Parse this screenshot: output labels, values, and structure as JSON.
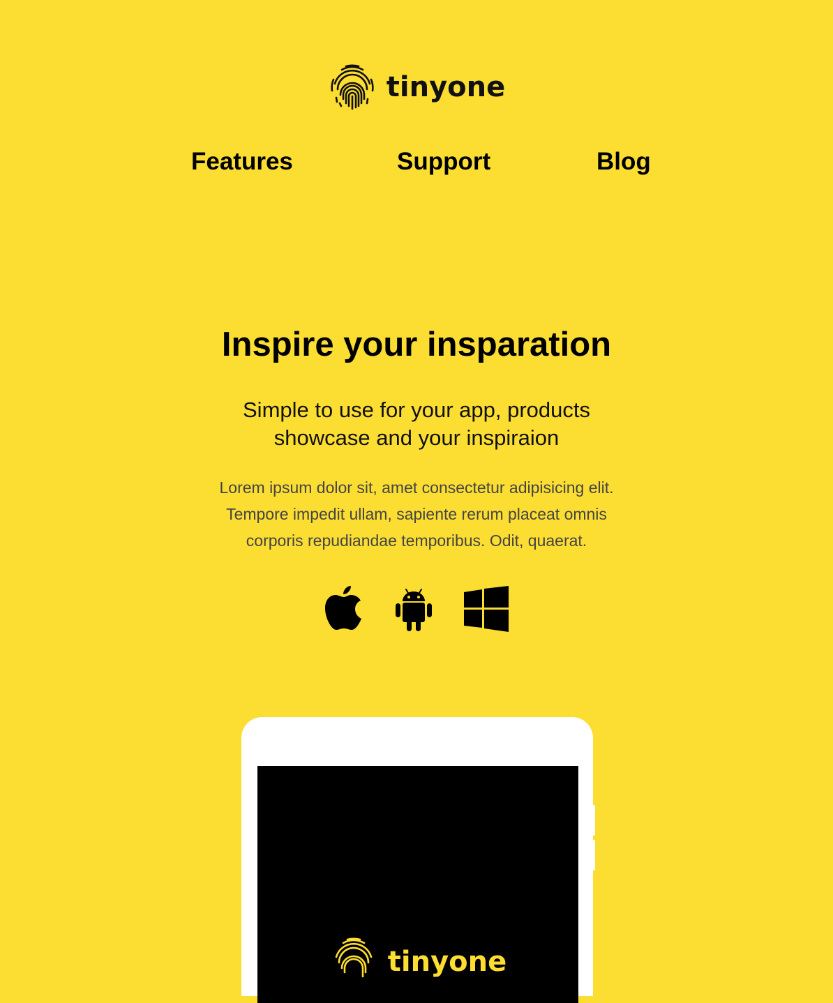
{
  "brand": {
    "name": "tinyone",
    "logo_icon": "fingerprint-icon"
  },
  "nav": {
    "items": [
      {
        "label": "Features"
      },
      {
        "label": "Support"
      },
      {
        "label": "Blog"
      }
    ]
  },
  "hero": {
    "title": "Inspire your insparation",
    "subtitle_lines": [
      "Simple to use for your app, products",
      "showcase and your inspiraion"
    ],
    "body_lines": [
      "Lorem ipsum dolor sit, amet consectetur adipisicing elit.",
      "Tempore impedit ullam, sapiente rerum placeat omnis",
      "corporis repudiandae temporibus. Odit, quaerat."
    ]
  },
  "platforms": [
    {
      "icon": "apple-icon"
    },
    {
      "icon": "android-icon"
    },
    {
      "icon": "windows-icon"
    }
  ],
  "device": {
    "screen_brand_name": "tinyone"
  },
  "colors": {
    "background": "#fcdd32",
    "text": "#000000",
    "muted_text": "#444444",
    "device_frame": "#ffffff",
    "screen": "#000000"
  }
}
